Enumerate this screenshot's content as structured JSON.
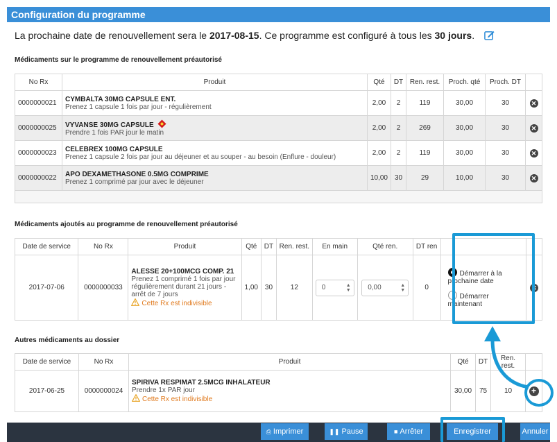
{
  "title": "Configuration du programme",
  "headline": {
    "prefix": "La prochaine date de renouvellement sera le ",
    "date": "2017-08-15",
    "middle": ". Ce programme est configuré à tous les ",
    "days": "30 jours",
    "suffix": "."
  },
  "section1": {
    "title": "Médicaments sur le programme de renouvellement préautorisé",
    "headers": [
      "No Rx",
      "Produit",
      "Qté",
      "DT",
      "Ren. rest.",
      "Proch. qté",
      "Proch. DT",
      ""
    ],
    "rows": [
      {
        "rx": "0000000021",
        "name": "CYMBALTA 30MG CAPSULE ENT.",
        "instr": "Prenez 1 capsule 1 fois par jour - régulièrement",
        "qte": "2,00",
        "dt": "2",
        "ren": "119",
        "pqte": "30,00",
        "pdt": "30"
      },
      {
        "rx": "0000000025",
        "name": "VYVANSE 30MG CAPSULE",
        "instr": "Prendre 1 fois PAR jour le matin",
        "qte": "2,00",
        "dt": "2",
        "ren": "269",
        "pqte": "30,00",
        "pdt": "30"
      },
      {
        "rx": "0000000023",
        "name": "CELEBREX 100MG CAPSULE",
        "instr": "Prenez 1 capsule 2 fois par jour au déjeuner et au souper - au besoin (Enflure - douleur)",
        "qte": "2,00",
        "dt": "2",
        "ren": "119",
        "pqte": "30,00",
        "pdt": "30"
      },
      {
        "rx": "0000000022",
        "name": "APO DEXAMETHASONE 0.5MG COMPRIME",
        "instr": "Prenez 1 comprimé par jour avec le déjeuner",
        "qte": "10,00",
        "dt": "30",
        "ren": "29",
        "pqte": "10,00",
        "pdt": "30"
      }
    ]
  },
  "section2": {
    "title": "Médicaments ajoutés au programme de renouvellement préautorisé",
    "headers": [
      "Date de service",
      "No Rx",
      "Produit",
      "Qté",
      "DT",
      "Ren. rest.",
      "En main",
      "Qté ren.",
      "DT ren"
    ],
    "row": {
      "date": "2017-07-06",
      "rx": "0000000033",
      "name": "ALESSE 20+100MCG COMP. 21",
      "instr": "Prenez 1 comprimé 1 fois par jour régulièrement durant 21 jours - arrêt de 7 jours",
      "warn": "Cette Rx est indivisible",
      "qte": "1,00",
      "dt": "30",
      "ren": "12",
      "enmain": "0",
      "qteren": "0,00",
      "dtren": "0",
      "opt1": "Démarrer à la prochaine date",
      "opt2": "Démarrer maintenant"
    }
  },
  "section3": {
    "title": "Autres médicaments au dossier",
    "headers": [
      "Date de service",
      "No Rx",
      "Produit",
      "Qté",
      "DT",
      "Ren. rest."
    ],
    "row": {
      "date": "2017-06-25",
      "rx": "0000000024",
      "name": "SPIRIVA RESPIMAT 2.5MCG INHALATEUR",
      "instr": "Prendre 1x PAR jour",
      "warn": "Cette Rx est indivisible",
      "qte": "30,00",
      "dt": "75",
      "ren": "10"
    }
  },
  "footer": {
    "print": "Imprimer",
    "pause": "Pause",
    "stop": "Arrêter",
    "save": "Enregistrer",
    "cancel": "Annuler"
  },
  "colors": {
    "accent": "#3a8fd8",
    "highlight": "#1a9ad6",
    "footer": "#2b3440",
    "warning": "#e07a1e"
  }
}
